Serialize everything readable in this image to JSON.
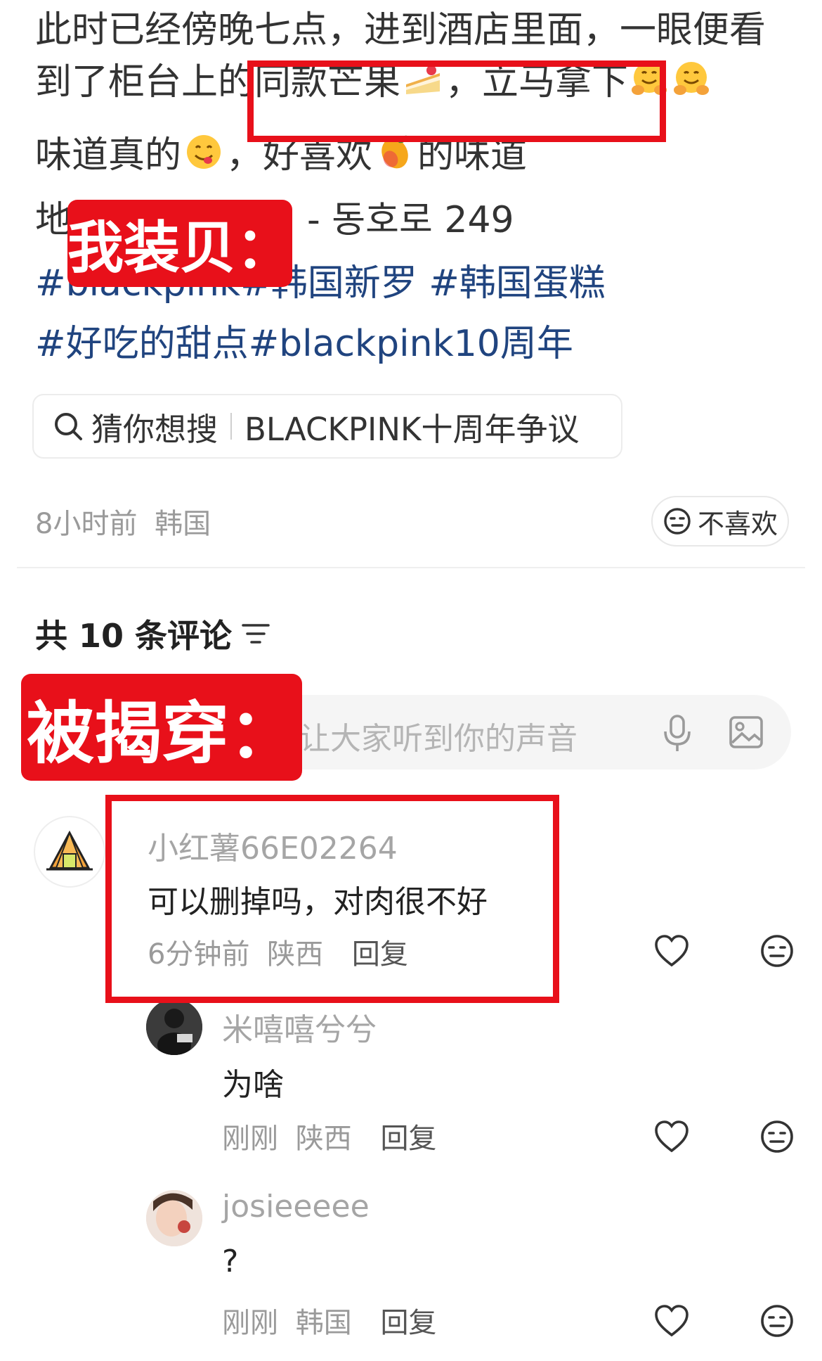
{
  "post": {
    "line1": "此时已经傍晚七点，进到酒店里面，一眼便看",
    "line2_a": "到了柜台上的",
    "line2_b": "同款芒果",
    "line2_c": "，立马拿下",
    "line3_a": "味道真的",
    "line3_b": "，好喜欢",
    "line3_c": "的味道",
    "line4_a": "地",
    "line4_b": "- 동호로 249",
    "hashtags": [
      "#blackpink",
      "#韩国新罗",
      "#韩国蛋糕",
      "#好吃的甜点",
      "#blackpink10周年"
    ]
  },
  "search": {
    "label": "猜你想搜",
    "query": "BLACKPINK十周年争议"
  },
  "meta": {
    "time": "8小时前",
    "location": "韩国",
    "dislike_label": "不喜欢"
  },
  "comments_header": {
    "count_text": "共 10 条评论"
  },
  "comment_input": {
    "placeholder": "让大家听到你的声音"
  },
  "overlays": {
    "label_top": "我装贝：",
    "label_bottom": "被揭穿："
  },
  "comments": [
    {
      "user": "小红薯66E02264",
      "text": "可以删掉吗，对肉很不好",
      "time": "6分钟前",
      "location": "陕西",
      "reply": "回复"
    },
    {
      "user": "米嘻嘻兮兮",
      "text": "为啥",
      "time": "刚刚",
      "location": "陕西",
      "reply": "回复"
    },
    {
      "user": "josieeeee",
      "text": "?",
      "time": "刚刚",
      "location": "韩国",
      "reply": "回复"
    }
  ],
  "icons": {
    "search": "search-icon",
    "dislike": "neutral-face-icon",
    "sort": "sort-icon",
    "mic": "microphone-icon",
    "image": "image-icon",
    "like": "heart-icon",
    "meh": "neutral-face-icon"
  },
  "colors": {
    "hashtag": "#20447f",
    "annotation_red": "#e8101a"
  }
}
